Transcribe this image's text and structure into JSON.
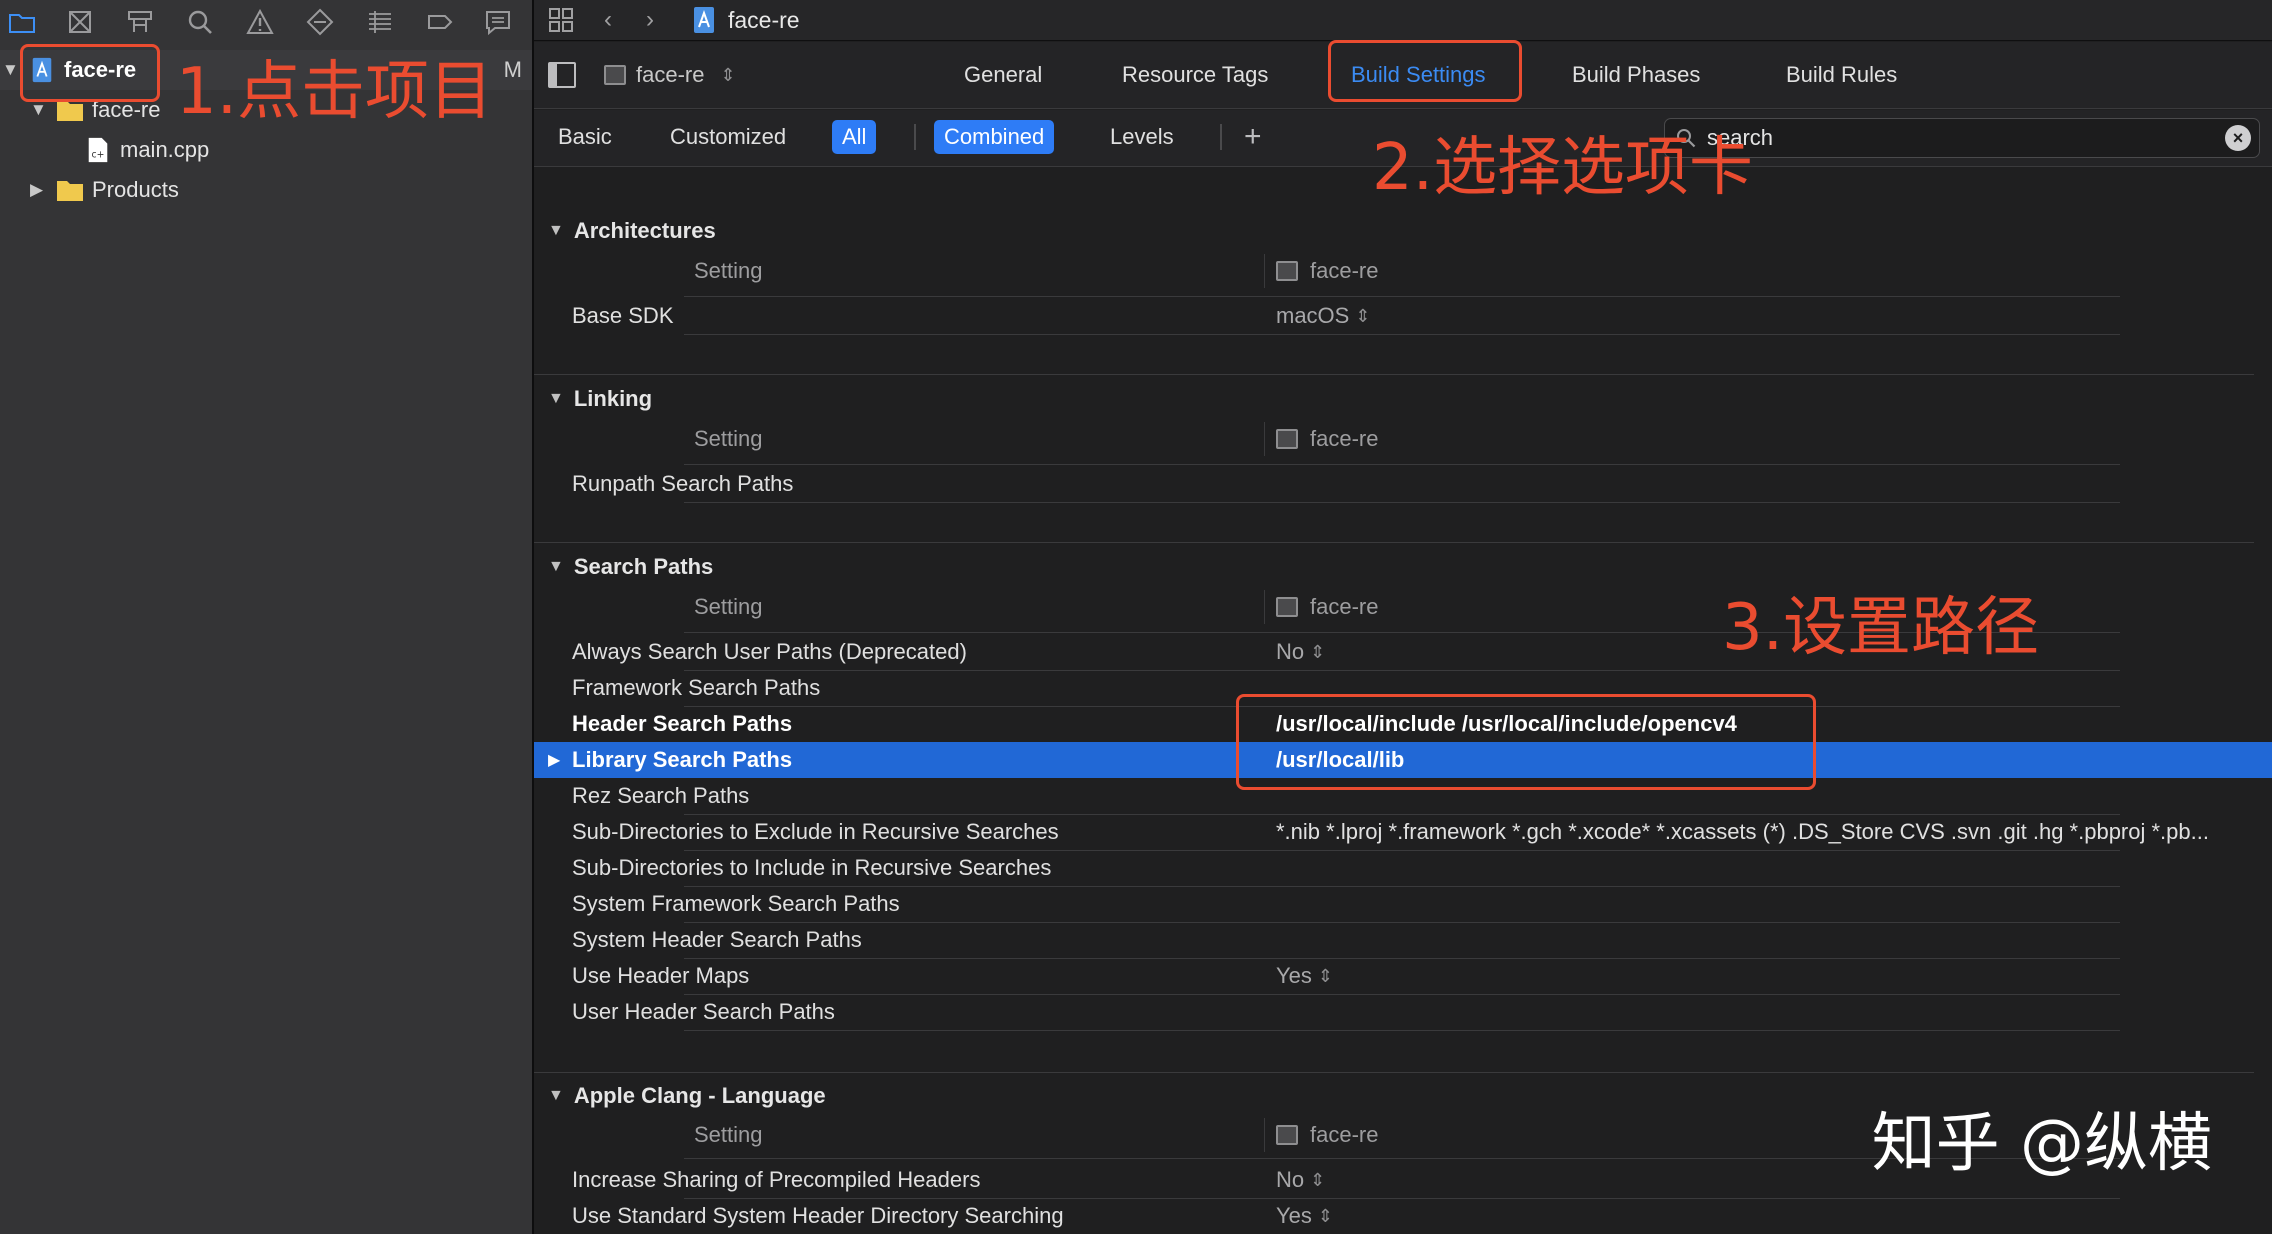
{
  "navigator": {
    "items": [
      {
        "label": "face-re",
        "badge": "M"
      },
      {
        "label": "face-re"
      },
      {
        "label": "main.cpp"
      },
      {
        "label": "Products"
      }
    ]
  },
  "jump_bar": {
    "title": "face-re"
  },
  "tabs": {
    "target": "face-re",
    "items": [
      "General",
      "Resource Tags",
      "Build Settings",
      "Build Phases",
      "Build Rules"
    ]
  },
  "scope": {
    "basic": "Basic",
    "customized": "Customized",
    "all": "All",
    "combined": "Combined",
    "levels": "Levels",
    "plus": "+"
  },
  "search": {
    "value": "search"
  },
  "sections": {
    "architectures": {
      "title": "Architectures",
      "setting_col": "Setting",
      "target_col": "face-re",
      "rows": [
        {
          "name": "Base SDK",
          "value": "macOS"
        }
      ]
    },
    "linking": {
      "title": "Linking",
      "setting_col": "Setting",
      "target_col": "face-re",
      "rows": [
        {
          "name": "Runpath Search Paths",
          "value": ""
        }
      ]
    },
    "search_paths": {
      "title": "Search Paths",
      "setting_col": "Setting",
      "target_col": "face-re",
      "rows": [
        {
          "name": "Always Search User Paths (Deprecated)",
          "value": "No"
        },
        {
          "name": "Framework Search Paths",
          "value": ""
        },
        {
          "name": "Header Search Paths",
          "value": "/usr/local/include /usr/local/include/opencv4"
        },
        {
          "name": "Library Search Paths",
          "value": "/usr/local/lib"
        },
        {
          "name": "Rez Search Paths",
          "value": ""
        },
        {
          "name": "Sub-Directories to Exclude in Recursive Searches",
          "value": "*.nib *.lproj *.framework *.gch *.xcode* *.xcassets (*) .DS_Store CVS .svn .git .hg *.pbproj *.pb..."
        },
        {
          "name": "Sub-Directories to Include in Recursive Searches",
          "value": ""
        },
        {
          "name": "System Framework Search Paths",
          "value": ""
        },
        {
          "name": "System Header Search Paths",
          "value": ""
        },
        {
          "name": "Use Header Maps",
          "value": "Yes"
        },
        {
          "name": "User Header Search Paths",
          "value": ""
        }
      ]
    },
    "clang_language": {
      "title": "Apple Clang - Language",
      "setting_col": "Setting",
      "target_col": "face-re",
      "rows": [
        {
          "name": "Increase Sharing of Precompiled Headers",
          "value": "No"
        },
        {
          "name": "Use Standard System Header Directory Searching",
          "value": "Yes"
        }
      ]
    }
  },
  "annotations": {
    "step1": "1.点击项目",
    "step2": "2.选择选项卡",
    "step3": "3.设置路径",
    "accent": "#ea4c30"
  },
  "watermark": "知乎 @纵横",
  "colors": {
    "accent_blue": "#2e7cf6",
    "selection_blue": "#2168d6",
    "background": "#1f1f20"
  }
}
